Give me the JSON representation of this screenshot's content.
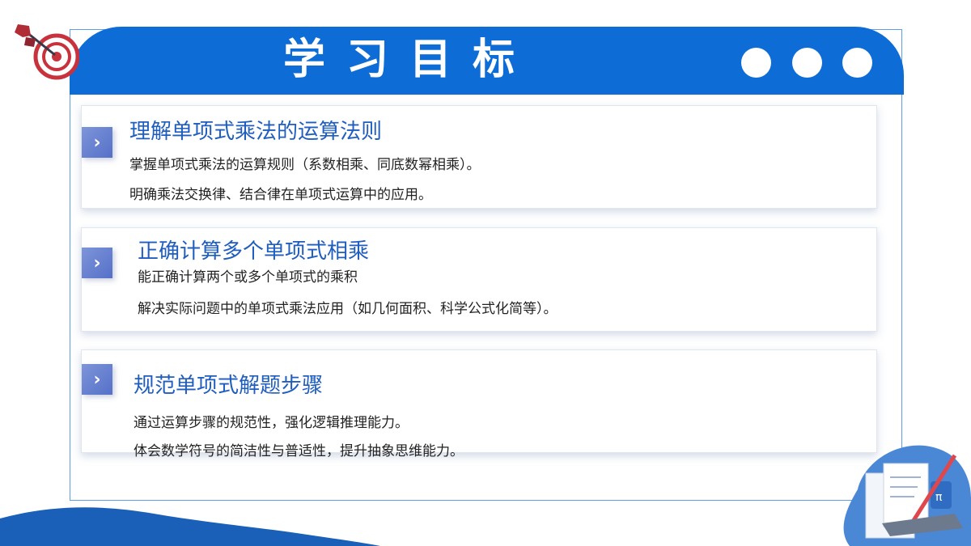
{
  "header": {
    "title": "学习目标",
    "color": "#0d6cd6"
  },
  "icons": {
    "target": "dartboard-target-icon",
    "decoration": "math-stationery-illustration",
    "arrow": "chevron-right-icon"
  },
  "cards": [
    {
      "title": "理解单项式乘法的运算法则",
      "lines": [
        "掌握单项式乘法的运算规则（系数相乘、同底数幂相乘）。",
        "明确乘法交换律、结合律在单项式运算中的应用。"
      ]
    },
    {
      "title": "正确计算多个单项式相乘",
      "lines": [
        "能正确计算两个或多个单项式的乘积",
        "解决实际问题中的单项式乘法应用（如几何面积、科学公式化简等）。"
      ]
    },
    {
      "title": "规范单项式解题步骤",
      "lines": [
        "通过运算步骤的规范性，强化逻辑推理能力。",
        "体会数学符号的简洁性与普适性，提升抽象思维能力。"
      ]
    }
  ],
  "arrow_glyph": "›"
}
